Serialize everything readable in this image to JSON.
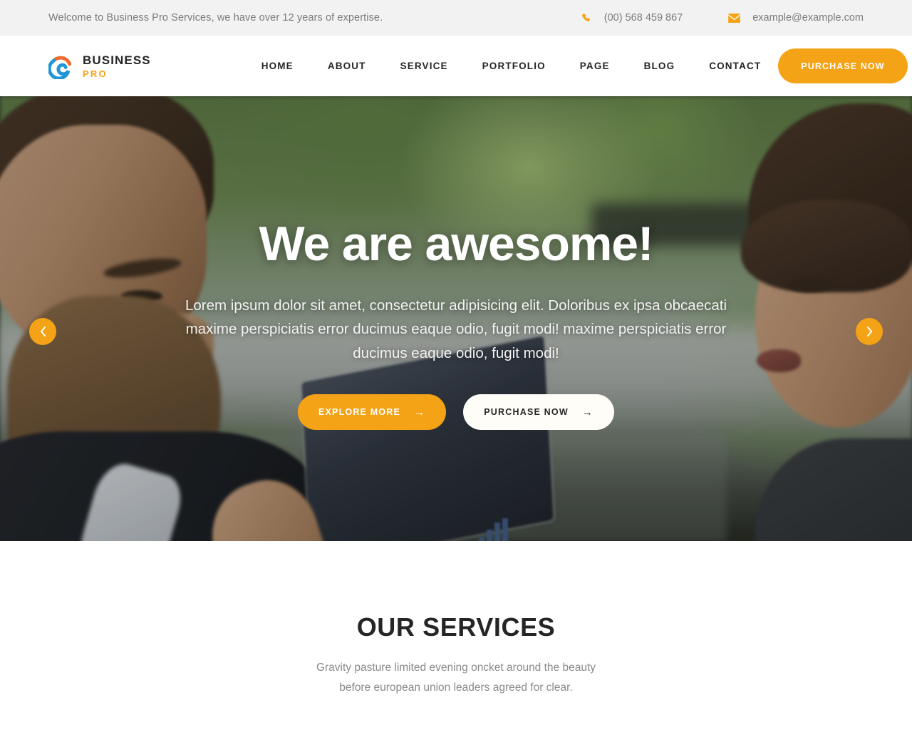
{
  "topbar": {
    "welcome": "Welcome to Business Pro Services, we have over 12 years of expertise.",
    "phone": "(00) 568 459 867",
    "email": "example@example.com",
    "phone_icon": "phone-icon",
    "email_icon": "envelope-icon"
  },
  "header": {
    "logo_name": "BUSINESS",
    "logo_sub": "PRO",
    "nav": [
      {
        "label": "HOME"
      },
      {
        "label": "ABOUT"
      },
      {
        "label": "SERVICE"
      },
      {
        "label": "PORTFOLIO"
      },
      {
        "label": "PAGE"
      },
      {
        "label": "BLOG"
      },
      {
        "label": "CONTACT"
      }
    ],
    "purchase_label": "PURCHASE NOW"
  },
  "hero": {
    "title": "We are awesome!",
    "text": "Lorem ipsum dolor sit amet, consectetur adipisicing elit. Doloribus ex ipsa obcaecati maxime perspiciatis error ducimus eaque odio, fugit modi! maxime perspiciatis error ducimus eaque odio, fugit modi!",
    "primary_label": "EXPLORE MORE",
    "secondary_label": "PURCHASE NOW",
    "arrow_glyph": "→",
    "prev_icon": "chevron-left-icon",
    "next_icon": "chevron-right-icon"
  },
  "services": {
    "title": "OUR SERVICES",
    "subtitle": "Gravity pasture limited evening oncket around the beauty before european union leaders agreed for clear."
  },
  "colors": {
    "accent": "#f5a316",
    "topbar_bg": "#f2f2f2",
    "text_dark": "#252525",
    "text_muted": "#8a8a8a"
  }
}
